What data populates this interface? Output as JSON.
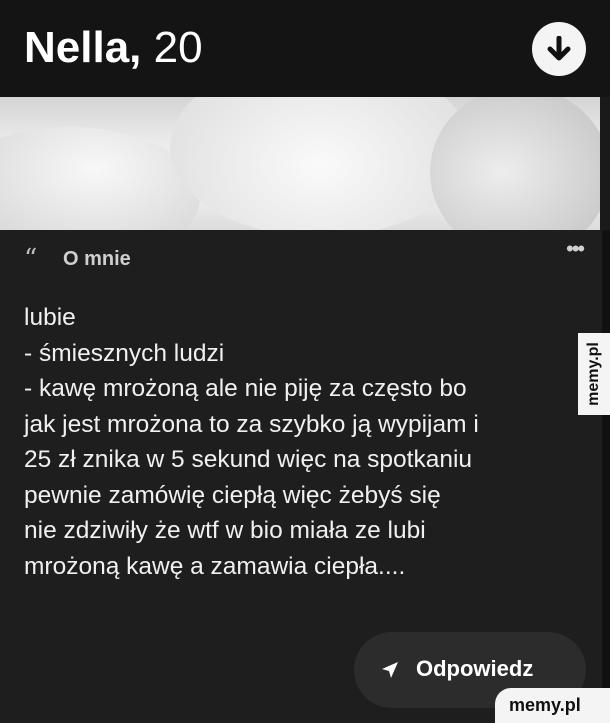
{
  "header": {
    "name": "Nella,",
    "age": "20",
    "download_icon": "arrow-down-icon"
  },
  "about": {
    "quote_icon": "“",
    "label": "O mnie",
    "more_icon": "•••",
    "lines": [
      "lubie",
      "-  śmiesznych ludzi",
      "- kawę mrożoną ale nie piję za często bo",
      "jak jest mrożona to za szybko ją wypijam i",
      "25 zł znika w 5 sekund więc na spotkaniu",
      "pewnie zamówię ciepłą więc żebyś się",
      "nie zdziwiły że wtf w bio miała ze lubi",
      "mrożoną kawę a zamawia ciepła...."
    ]
  },
  "reply": {
    "label": "Odpowiedz",
    "icon": "send-icon"
  },
  "watermark": {
    "side": "memy.pl",
    "corner": "memy.pl"
  },
  "colors": {
    "background": "#111111",
    "card": "#1e1e1e",
    "button": "#2c2c2c",
    "text": "#f0f0f0"
  }
}
